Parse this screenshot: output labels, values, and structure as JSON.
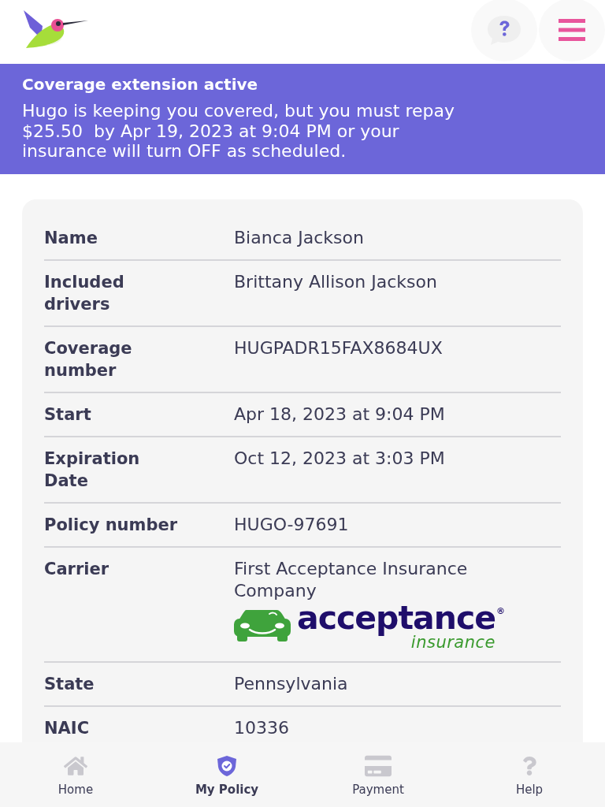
{
  "banner": {
    "title": "Coverage extension active",
    "message": "Hugo is keeping you covered, but you must repay $25.50  by Apr 19, 2023 at 9:04 PM or your insurance will turn OFF as scheduled."
  },
  "details": [
    {
      "label": "Name",
      "value": "Bianca Jackson"
    },
    {
      "label": "Included drivers",
      "value": "Brittany Allison Jackson"
    },
    {
      "label": "Coverage number",
      "value": "HUGPADR15FAX8684UX"
    },
    {
      "label": "Start",
      "value": "Apr 18, 2023 at 9:04 PM"
    },
    {
      "label": "Expiration Date",
      "value": "Oct 12, 2023 at 3:03 PM"
    },
    {
      "label": "Policy number",
      "value": "HUGO-97691"
    },
    {
      "label": "Carrier",
      "value": "First Acceptance Insurance Company",
      "logo": {
        "wordmark": "acceptance",
        "registered": "®",
        "tagline": "insurance"
      }
    },
    {
      "label": "State",
      "value": "Pennsylvania"
    },
    {
      "label": "NAIC",
      "value": "10336"
    }
  ],
  "nav": {
    "items": [
      {
        "label": "Home",
        "selected": false
      },
      {
        "label": "My Policy",
        "selected": true
      },
      {
        "label": "Payment",
        "selected": false
      },
      {
        "label": "Help",
        "selected": false
      }
    ]
  }
}
